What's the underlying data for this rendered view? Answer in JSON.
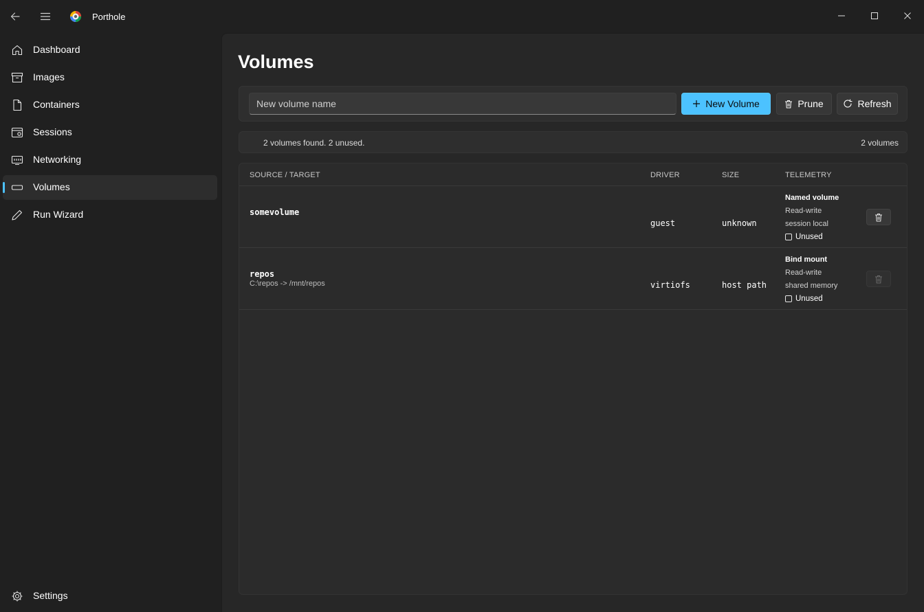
{
  "window": {
    "title": "Porthole"
  },
  "sidebar": {
    "items": [
      {
        "label": "Dashboard",
        "icon": "home-icon"
      },
      {
        "label": "Images",
        "icon": "archive-icon"
      },
      {
        "label": "Containers",
        "icon": "document-icon"
      },
      {
        "label": "Sessions",
        "icon": "session-icon"
      },
      {
        "label": "Networking",
        "icon": "network-icon"
      },
      {
        "label": "Volumes",
        "icon": "volume-icon",
        "active": true
      },
      {
        "label": "Run Wizard",
        "icon": "pencil-icon"
      }
    ],
    "settings_label": "Settings"
  },
  "page": {
    "title": "Volumes"
  },
  "toolbar": {
    "input_placeholder": "New volume name",
    "new_volume_label": "New Volume",
    "prune_label": "Prune",
    "refresh_label": "Refresh"
  },
  "status": {
    "summary": "2 volumes found. 2 unused.",
    "count": "2 volumes"
  },
  "table": {
    "columns": [
      "SOURCE / TARGET",
      "DRIVER",
      "SIZE",
      "TELEMETRY"
    ],
    "rows": [
      {
        "name": "somevolume",
        "subtitle": "",
        "driver": "guest",
        "size": "unknown",
        "telemetry_title": "Named volume",
        "telemetry_line1": "Read-write",
        "telemetry_line2": "session local",
        "telemetry_status": "Unused",
        "delete_enabled": true
      },
      {
        "name": "repos",
        "subtitle": "C:\\repos -> /mnt/repos",
        "driver": "virtiofs",
        "size": "host path",
        "telemetry_title": "Bind mount",
        "telemetry_line1": "Read-write",
        "telemetry_line2": "shared memory",
        "telemetry_status": "Unused",
        "delete_enabled": false
      }
    ]
  },
  "colors": {
    "accent": "#4cc2ff",
    "background": "#202020",
    "content": "#272727"
  }
}
